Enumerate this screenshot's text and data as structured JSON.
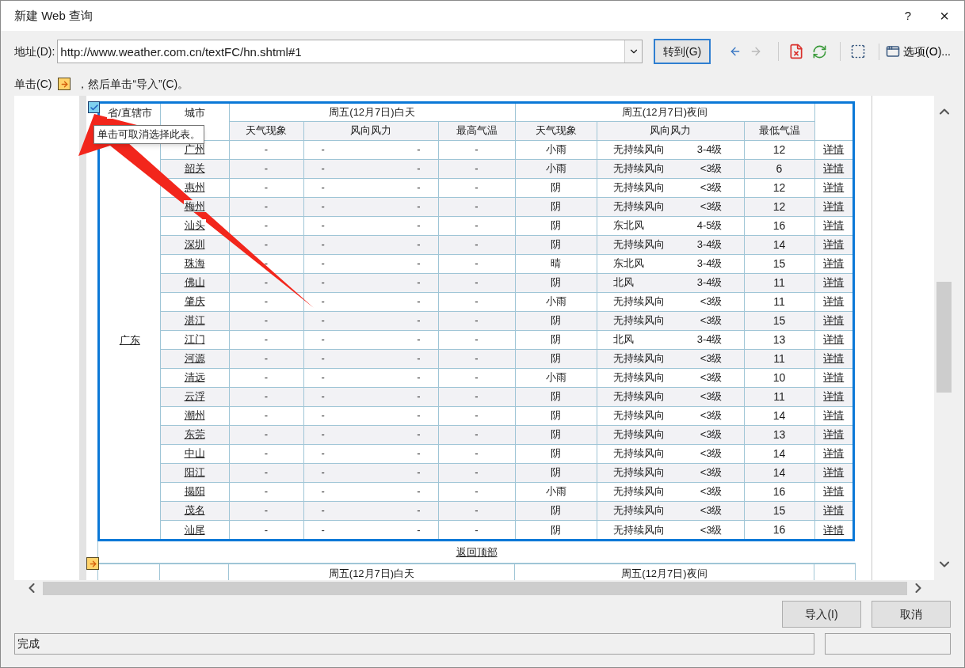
{
  "window": {
    "title": "新建 Web 查询",
    "help": "?",
    "close": "×"
  },
  "address_bar": {
    "label": "地址(D):",
    "value": "http://www.weather.com.cn/textFC/hn.shtml#1",
    "go_button": "转到(G)"
  },
  "toolbar": [
    {
      "kind": "back",
      "disabled": false
    },
    {
      "kind": "forward",
      "disabled": true
    },
    {
      "kind": "stop",
      "disabled": false
    },
    {
      "kind": "refresh",
      "disabled": false
    },
    {
      "kind": "save",
      "disabled": false
    },
    {
      "kind": "options",
      "disabled": false,
      "label": "选项(O)..."
    }
  ],
  "instruction": {
    "before": "单击(C)",
    "after": "，然后单击“导入”(C)。"
  },
  "table": {
    "selected": true,
    "tooltip": "单击可取消选择此表。",
    "headers": {
      "province": "省/直辖市",
      "city": "城市",
      "day_group": "周五(12月7日)白天",
      "night_group": "周五(12月7日)夜间",
      "day_columns": [
        "天气现象",
        "风向风力",
        "最高气温"
      ],
      "night_columns": [
        "天气现象",
        "风向风力",
        "最低气温"
      ]
    },
    "province": "广东",
    "rows": [
      {
        "city": "广州",
        "day": [
          "-",
          "-",
          "-",
          "-"
        ],
        "night_weather": "小雨",
        "night_wind_direction": "无持续风向",
        "night_wind_level": "3-4级",
        "low": "12",
        "details": "详情"
      },
      {
        "city": "韶关",
        "day": [
          "-",
          "-",
          "-",
          "-"
        ],
        "night_weather": "小雨",
        "night_wind_direction": "无持续风向",
        "night_wind_level": "<3级",
        "low": "6",
        "details": "详情"
      },
      {
        "city": "惠州",
        "day": [
          "-",
          "-",
          "-",
          "-"
        ],
        "night_weather": "阴",
        "night_wind_direction": "无持续风向",
        "night_wind_level": "<3级",
        "low": "12",
        "details": "详情"
      },
      {
        "city": "梅州",
        "day": [
          "-",
          "-",
          "-",
          "-"
        ],
        "night_weather": "阴",
        "night_wind_direction": "无持续风向",
        "night_wind_level": "<3级",
        "low": "12",
        "details": "详情"
      },
      {
        "city": "汕头",
        "day": [
          "-",
          "-",
          "-",
          "-"
        ],
        "night_weather": "阴",
        "night_wind_direction": "东北风",
        "night_wind_level": "4-5级",
        "low": "16",
        "details": "详情"
      },
      {
        "city": "深圳",
        "day": [
          "-",
          "-",
          "-",
          "-"
        ],
        "night_weather": "阴",
        "night_wind_direction": "无持续风向",
        "night_wind_level": "3-4级",
        "low": "14",
        "details": "详情"
      },
      {
        "city": "珠海",
        "day": [
          "-",
          "-",
          "-",
          "-"
        ],
        "night_weather": "晴",
        "night_wind_direction": "东北风",
        "night_wind_level": "3-4级",
        "low": "15",
        "details": "详情"
      },
      {
        "city": "佛山",
        "day": [
          "-",
          "-",
          "-",
          "-"
        ],
        "night_weather": "阴",
        "night_wind_direction": "北风",
        "night_wind_level": "3-4级",
        "low": "11",
        "details": "详情"
      },
      {
        "city": "肇庆",
        "day": [
          "-",
          "-",
          "-",
          "-"
        ],
        "night_weather": "小雨",
        "night_wind_direction": "无持续风向",
        "night_wind_level": "<3级",
        "low": "11",
        "details": "详情"
      },
      {
        "city": "湛江",
        "day": [
          "-",
          "-",
          "-",
          "-"
        ],
        "night_weather": "阴",
        "night_wind_direction": "无持续风向",
        "night_wind_level": "<3级",
        "low": "15",
        "details": "详情"
      },
      {
        "city": "江门",
        "day": [
          "-",
          "-",
          "-",
          "-"
        ],
        "night_weather": "阴",
        "night_wind_direction": "北风",
        "night_wind_level": "3-4级",
        "low": "13",
        "details": "详情"
      },
      {
        "city": "河源",
        "day": [
          "-",
          "-",
          "-",
          "-"
        ],
        "night_weather": "阴",
        "night_wind_direction": "无持续风向",
        "night_wind_level": "<3级",
        "low": "11",
        "details": "详情"
      },
      {
        "city": "清远",
        "day": [
          "-",
          "-",
          "-",
          "-"
        ],
        "night_weather": "小雨",
        "night_wind_direction": "无持续风向",
        "night_wind_level": "<3级",
        "low": "10",
        "details": "详情"
      },
      {
        "city": "云浮",
        "day": [
          "-",
          "-",
          "-",
          "-"
        ],
        "night_weather": "阴",
        "night_wind_direction": "无持续风向",
        "night_wind_level": "<3级",
        "low": "11",
        "details": "详情"
      },
      {
        "city": "潮州",
        "day": [
          "-",
          "-",
          "-",
          "-"
        ],
        "night_weather": "阴",
        "night_wind_direction": "无持续风向",
        "night_wind_level": "<3级",
        "low": "14",
        "details": "详情"
      },
      {
        "city": "东莞",
        "day": [
          "-",
          "-",
          "-",
          "-"
        ],
        "night_weather": "阴",
        "night_wind_direction": "无持续风向",
        "night_wind_level": "<3级",
        "low": "13",
        "details": "详情"
      },
      {
        "city": "中山",
        "day": [
          "-",
          "-",
          "-",
          "-"
        ],
        "night_weather": "阴",
        "night_wind_direction": "无持续风向",
        "night_wind_level": "<3级",
        "low": "14",
        "details": "详情"
      },
      {
        "city": "阳江",
        "day": [
          "-",
          "-",
          "-",
          "-"
        ],
        "night_weather": "阴",
        "night_wind_direction": "无持续风向",
        "night_wind_level": "<3级",
        "low": "14",
        "details": "详情"
      },
      {
        "city": "揭阳",
        "day": [
          "-",
          "-",
          "-",
          "-"
        ],
        "night_weather": "小雨",
        "night_wind_direction": "无持续风向",
        "night_wind_level": "<3级",
        "low": "16",
        "details": "详情"
      },
      {
        "city": "茂名",
        "day": [
          "-",
          "-",
          "-",
          "-"
        ],
        "night_weather": "阴",
        "night_wind_direction": "无持续风向",
        "night_wind_level": "<3级",
        "low": "15",
        "details": "详情"
      },
      {
        "city": "汕尾",
        "day": [
          "-",
          "-",
          "-",
          "-"
        ],
        "night_weather": "阴",
        "night_wind_direction": "无持续风向",
        "night_wind_level": "<3级",
        "low": "16",
        "details": "详情"
      }
    ]
  },
  "back_to_top": "返回顶部",
  "next_table": {
    "selected": false,
    "day_group": "周五(12月7日)白天",
    "night_group": "周五(12月7日)夜间"
  },
  "buttons": {
    "import": "导入(I)",
    "cancel": "取消"
  },
  "status_bar": {
    "text": "完成"
  }
}
